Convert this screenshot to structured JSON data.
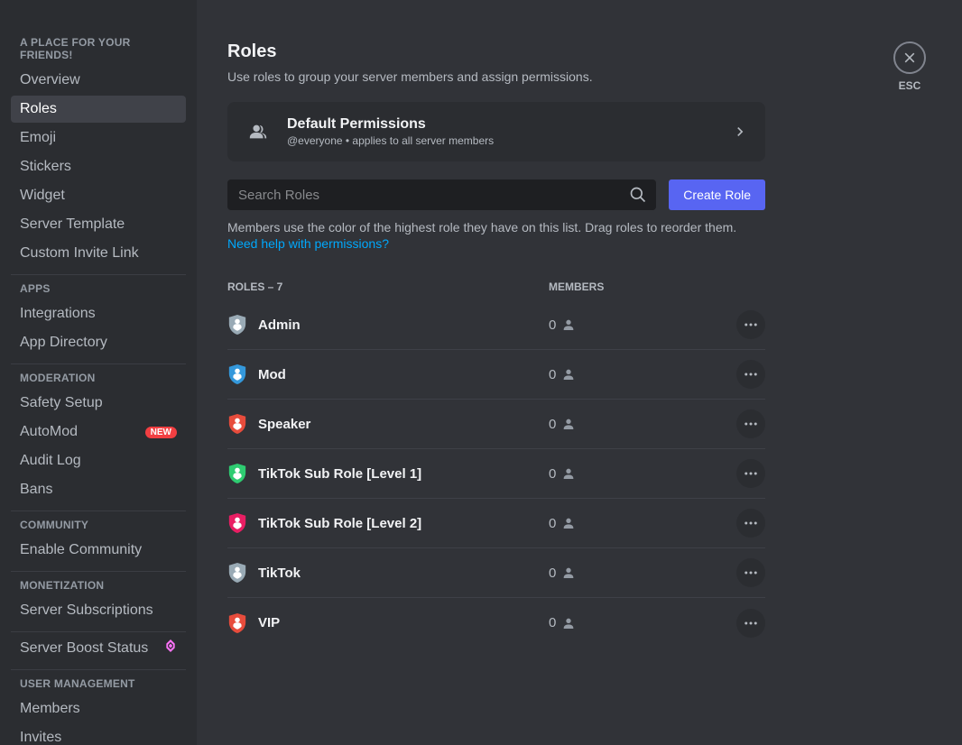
{
  "sidebar": {
    "sections": [
      {
        "header": "A PLACE FOR YOUR FRIENDS!",
        "items": [
          {
            "label": "Overview"
          },
          {
            "label": "Roles",
            "active": true
          },
          {
            "label": "Emoji"
          },
          {
            "label": "Stickers"
          },
          {
            "label": "Widget"
          },
          {
            "label": "Server Template"
          },
          {
            "label": "Custom Invite Link"
          }
        ]
      },
      {
        "header": "APPS",
        "items": [
          {
            "label": "Integrations"
          },
          {
            "label": "App Directory"
          }
        ]
      },
      {
        "header": "MODERATION",
        "items": [
          {
            "label": "Safety Setup"
          },
          {
            "label": "AutoMod",
            "badge": "NEW"
          },
          {
            "label": "Audit Log"
          },
          {
            "label": "Bans"
          }
        ]
      },
      {
        "header": "COMMUNITY",
        "items": [
          {
            "label": "Enable Community"
          }
        ]
      },
      {
        "header": "MONETIZATION",
        "items": [
          {
            "label": "Server Subscriptions"
          }
        ]
      },
      {
        "header": "",
        "items": [
          {
            "label": "Server Boost Status",
            "boost": true
          }
        ]
      },
      {
        "header": "USER MANAGEMENT",
        "items": [
          {
            "label": "Members"
          },
          {
            "label": "Invites"
          }
        ]
      }
    ]
  },
  "page": {
    "title": "Roles",
    "subtitle": "Use roles to group your server members and assign permissions.",
    "defaultPerms": {
      "title": "Default Permissions",
      "subtitle": "@everyone • applies to all server members"
    },
    "search": {
      "placeholder": "Search Roles"
    },
    "createButton": "Create Role",
    "helpText": "Members use the color of the highest role they have on this list. Drag roles to reorder them. ",
    "helpLink": "Need help with permissions?",
    "listHeader": {
      "roles": "ROLES – 7",
      "members": "MEMBERS"
    },
    "roles": [
      {
        "name": "Admin",
        "members": "0",
        "color": "#99aab5"
      },
      {
        "name": "Mod",
        "members": "0",
        "color": "#3498db"
      },
      {
        "name": "Speaker",
        "members": "0",
        "color": "#e74c3c"
      },
      {
        "name": "TikTok Sub Role [Level 1]",
        "members": "0",
        "color": "#2ecc71"
      },
      {
        "name": "TikTok Sub Role [Level 2]",
        "members": "0",
        "color": "#e91e63"
      },
      {
        "name": "TikTok",
        "members": "0",
        "color": "#99aab5"
      },
      {
        "name": "VIP",
        "members": "0",
        "color": "#e74c3c"
      }
    ],
    "close": {
      "label": "ESC"
    }
  }
}
